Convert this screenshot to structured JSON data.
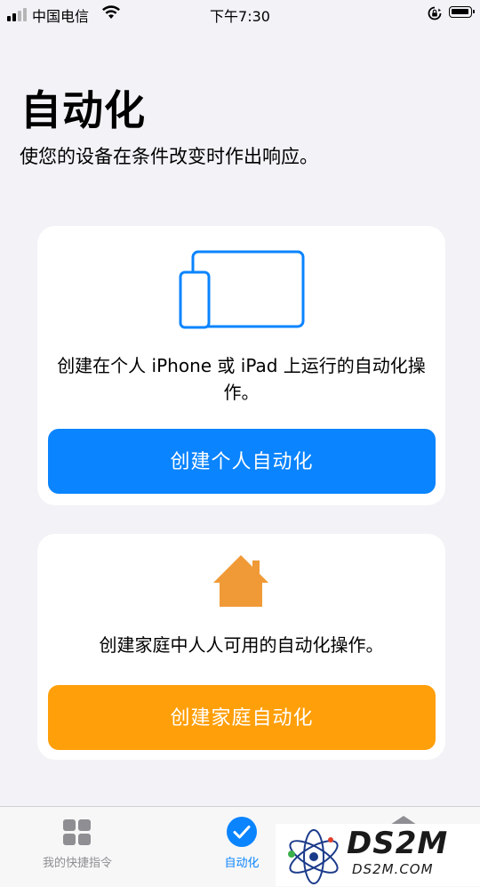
{
  "status_bar": {
    "carrier": "中国电信",
    "time": "下午7:30"
  },
  "header": {
    "title": "自动化",
    "subtitle": "使您的设备在条件改变时作出响应。"
  },
  "personal_card": {
    "icon": "iphone-ipad-icon",
    "description": "创建在个人 iPhone 或 iPad 上运行的自动化操作。",
    "button_label": "创建个人自动化",
    "button_color": "#0a84ff"
  },
  "home_card": {
    "icon": "home-icon",
    "description": "创建家庭中人人可用的自动化操作。",
    "button_label": "创建家庭自动化",
    "button_color": "#ff9f0a"
  },
  "tab_bar": {
    "tabs": [
      {
        "label": "我的快捷指令",
        "icon": "grid-icon",
        "active": false
      },
      {
        "label": "自动化",
        "icon": "checkmark-circle-icon",
        "active": true
      },
      {
        "label": "",
        "icon": "layers-icon",
        "active": false
      }
    ]
  },
  "watermark": {
    "brand": "DS2M",
    "url": "DS2M.COM"
  },
  "colors": {
    "accent": "#0a84ff",
    "home": "#ff9f0a",
    "background": "#f2f2f7"
  }
}
